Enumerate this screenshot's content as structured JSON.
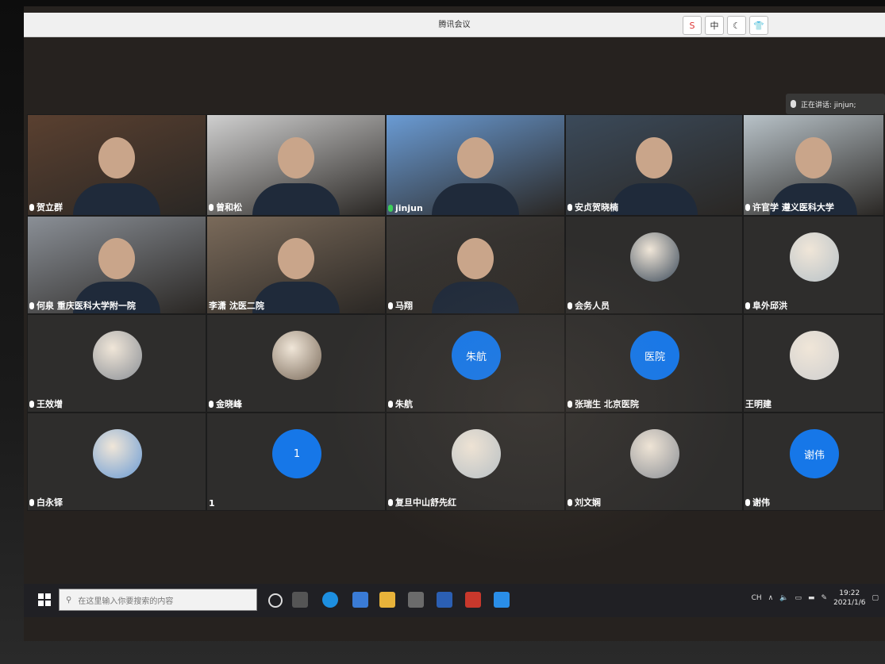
{
  "window": {
    "title": "腾讯会议"
  },
  "titlebar_icons": [
    {
      "name": "sogou-s-icon",
      "label": "S"
    },
    {
      "name": "ime-chinese-icon",
      "label": "中"
    },
    {
      "name": "moon-icon",
      "label": "☾"
    },
    {
      "name": "shirt-icon",
      "label": "👕"
    }
  ],
  "speaking": {
    "label": "正在讲话: jinjun;"
  },
  "participants": [
    {
      "name": "贺立群",
      "kind": "video",
      "row": 0,
      "col": 0,
      "icon": "mic-muted-icon"
    },
    {
      "name": "曾和松",
      "kind": "video",
      "row": 0,
      "col": 1,
      "icon": "mic-icon"
    },
    {
      "name": "jinjun",
      "kind": "video",
      "row": 0,
      "col": 2,
      "icon": "mic-speaking-icon"
    },
    {
      "name": "安贞贺晓楠",
      "kind": "video",
      "row": 0,
      "col": 3,
      "icon": "mic-icon"
    },
    {
      "name": "许官学 遵义医科大学",
      "kind": "video",
      "row": 0,
      "col": 4,
      "icon": "mic-muted-icon"
    },
    {
      "name": "何泉 重庆医科大学附一院",
      "kind": "video",
      "row": 1,
      "col": 0,
      "icon": "mic-muted-icon"
    },
    {
      "name": "李潇 沈医二院",
      "kind": "video",
      "row": 1,
      "col": 1,
      "icon": ""
    },
    {
      "name": "马翔",
      "kind": "video",
      "row": 1,
      "col": 2,
      "icon": "mic-muted-icon"
    },
    {
      "name": "会务人员",
      "kind": "avatar",
      "row": 1,
      "col": 3,
      "icon": "mic-muted-icon"
    },
    {
      "name": "阜外邱洪",
      "kind": "avatar",
      "row": 1,
      "col": 4,
      "icon": "mic-muted-icon"
    },
    {
      "name": "王效增",
      "kind": "avatar",
      "row": 2,
      "col": 0,
      "icon": "mic-muted-icon"
    },
    {
      "name": "金晓峰",
      "kind": "avatar",
      "row": 2,
      "col": 1,
      "icon": "mic-muted-icon"
    },
    {
      "name": "朱航",
      "kind": "avatar-text",
      "avatar_text": "朱航",
      "row": 2,
      "col": 2,
      "icon": "mic-muted-icon"
    },
    {
      "name": "张瑞生 北京医院",
      "kind": "avatar-text",
      "avatar_text": "医院",
      "row": 2,
      "col": 3,
      "icon": "mic-muted-icon"
    },
    {
      "name": "王明建",
      "kind": "avatar",
      "row": 2,
      "col": 4,
      "icon": ""
    },
    {
      "name": "白永铎",
      "kind": "avatar",
      "row": 3,
      "col": 0,
      "icon": "mic-muted-icon"
    },
    {
      "name": "1",
      "kind": "avatar-text",
      "avatar_text": "1",
      "row": 3,
      "col": 1,
      "icon": ""
    },
    {
      "name": "复旦中山舒先红",
      "kind": "avatar",
      "row": 3,
      "col": 2,
      "icon": "mic-muted-icon"
    },
    {
      "name": "刘文娴",
      "kind": "avatar",
      "row": 3,
      "col": 3,
      "icon": "mic-muted-icon"
    },
    {
      "name": "谢伟",
      "kind": "avatar-text",
      "avatar_text": "谢伟",
      "row": 3,
      "col": 4,
      "icon": "mic-muted-icon"
    }
  ],
  "taskbar": {
    "search_placeholder": "在这里输入你要搜索的内容",
    "ime": "CH",
    "time": "19:22",
    "date": "2021/1/6"
  },
  "colors": {
    "avatar_blue": "#1677e8",
    "taskbar": "#202024"
  }
}
